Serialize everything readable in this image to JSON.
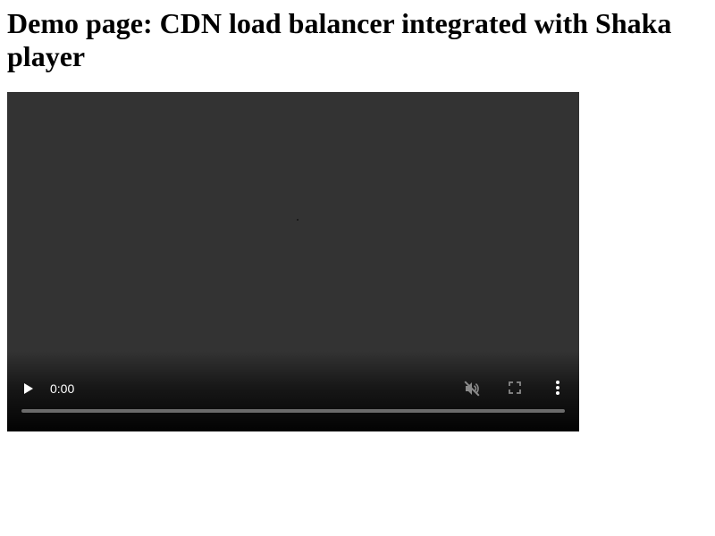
{
  "page": {
    "title": "Demo page: CDN load balancer integrated with Shaka player"
  },
  "player": {
    "current_time": "0:00",
    "progress": 0,
    "muted": true,
    "icons": {
      "play": "play-icon",
      "mute": "volume-muted-icon",
      "fullscreen": "fullscreen-icon",
      "more": "more-vert-icon"
    },
    "colors": {
      "surface": "#333333",
      "control_icon": "#ffffff",
      "disabled_icon": "#8a8a8a",
      "seek_track": "#6b6b6b"
    }
  }
}
